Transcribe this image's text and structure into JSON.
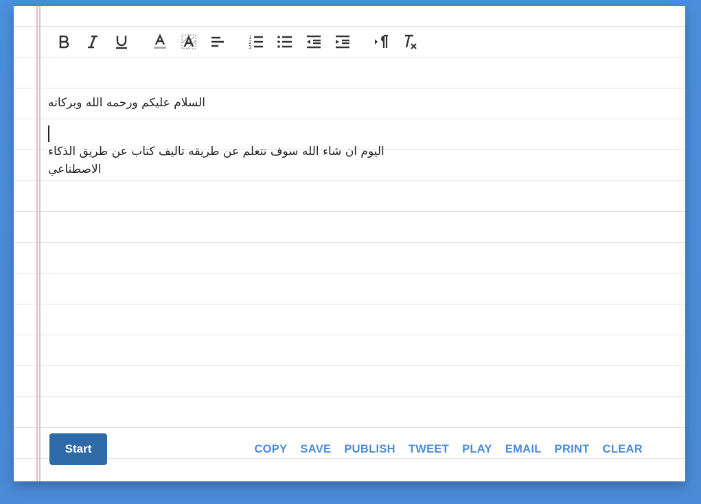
{
  "toolbar": {
    "buttons": [
      {
        "name": "bold-icon"
      },
      {
        "name": "italic-icon"
      },
      {
        "name": "underline-icon"
      },
      {
        "name": "text-color-icon"
      },
      {
        "name": "highlight-color-icon"
      },
      {
        "name": "align-left-icon"
      },
      {
        "name": "ordered-list-icon"
      },
      {
        "name": "bullet-list-icon"
      },
      {
        "name": "outdent-icon"
      },
      {
        "name": "indent-icon"
      },
      {
        "name": "text-direction-icon"
      },
      {
        "name": "clear-formatting-icon"
      }
    ]
  },
  "editor": {
    "lines": [
      "السلام عليكم ورحمه الله وبركاته",
      "اليوم ان شاء الله سوف نتعلم عن طريقه تاليف كتاب عن طريق الذكاء الاصطناعي"
    ]
  },
  "start_button": "Start",
  "actions": [
    "COPY",
    "SAVE",
    "PUBLISH",
    "TWEET",
    "PLAY",
    "EMAIL",
    "PRINT",
    "CLEAR"
  ],
  "colors": {
    "background": "#4a8ad6",
    "start_button": "#2d6aa7",
    "action_link": "#4a8ad6",
    "margin_line": "#f0b8c8"
  }
}
